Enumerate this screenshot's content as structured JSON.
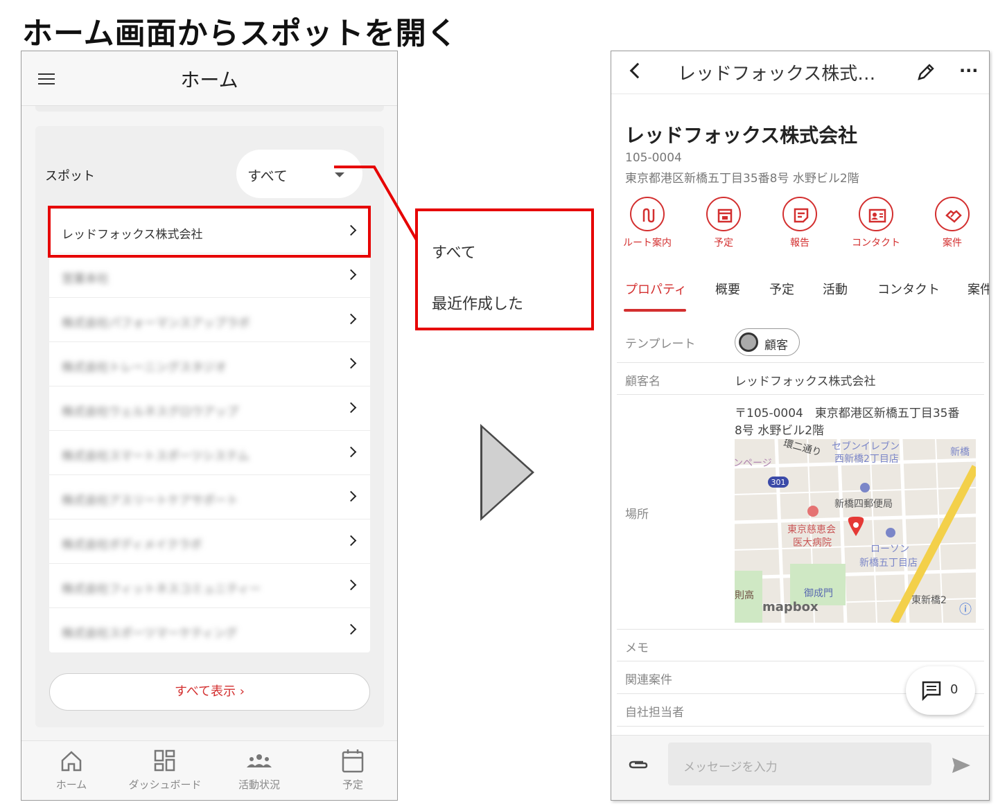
{
  "title": "ホーム画面からスポットを開く",
  "left_phone": {
    "header_title": "ホーム",
    "spot_label": "スポット",
    "filter_value": "すべて",
    "spots": [
      {
        "name": "レッドフォックス株式会社",
        "blurred": false
      },
      {
        "name": "営業本社",
        "blurred": true
      },
      {
        "name": "株式会社パフォーマンスアップラボ",
        "blurred": true
      },
      {
        "name": "株式会社トレーニングスタジオ",
        "blurred": true
      },
      {
        "name": "株式会社ウェルネスグロウアップ",
        "blurred": true
      },
      {
        "name": "株式会社スマートスポーツシステム",
        "blurred": true
      },
      {
        "name": "株式会社アスリートケアサポート",
        "blurred": true
      },
      {
        "name": "株式会社ボディメイクラボ",
        "blurred": true
      },
      {
        "name": "株式会社フィットネスコミュニティー",
        "blurred": true
      },
      {
        "name": "株式会社スポーツマーケティング",
        "blurred": true
      }
    ],
    "show_all": "すべて表示 ›",
    "nav": [
      {
        "label": "ホーム",
        "icon": "home-icon"
      },
      {
        "label": "ダッシュボード",
        "icon": "dashboard-icon"
      },
      {
        "label": "活動状況",
        "icon": "people-icon"
      },
      {
        "label": "予定",
        "icon": "calendar-icon"
      }
    ]
  },
  "dropdown_menu": {
    "items": [
      "すべて",
      "最近作成した"
    ]
  },
  "right_phone": {
    "header_title": "レッドフォックス株式…",
    "company_name": "レッドフォックス株式会社",
    "postal_code": "105-0004",
    "address": "東京都港区新橋五丁目35番8号 水野ビル2階",
    "actions": [
      {
        "label": "ルート案内",
        "icon": "route-icon"
      },
      {
        "label": "予定",
        "icon": "calendar-icon"
      },
      {
        "label": "報告",
        "icon": "report-icon"
      },
      {
        "label": "コンタクト",
        "icon": "contact-card-icon"
      },
      {
        "label": "案件",
        "icon": "handshake-icon"
      }
    ],
    "tabs": [
      "プロパティ",
      "概要",
      "予定",
      "活動",
      "コンタクト",
      "案件"
    ],
    "properties": {
      "template_label": "テンプレート",
      "template_value": "顧客",
      "customer_name_label": "顧客名",
      "customer_name_value": "レッドフォックス株式会社",
      "location_label": "場所",
      "location_address_line1": "〒105-0004　東京都港区新橋五丁目35番",
      "location_address_line2": "8号 水野ビル2階",
      "memo_label": "メモ",
      "related_label": "関連案件",
      "owner_label": "自社担当者"
    },
    "map_labels": {
      "street": "環二通り",
      "seven": "セブンイレブン",
      "seven_branch": "西新橋2丁目店",
      "shinbashi": "新橋",
      "route": "301",
      "post": "新橋四郵便局",
      "hospital1": "東京慈恵会",
      "hospital2": "医大病院",
      "lawson": "ローソン",
      "lawson_branch": "新橋五丁目店",
      "onarimon": "御成門",
      "higashi": "東新橋2",
      "logo": "mapbox",
      "left_edge": "ンページ",
      "sokuko": "則高"
    },
    "comment_count": "0",
    "message_placeholder": "メッセージを入力"
  },
  "colors": {
    "accent": "#d32f2f",
    "highlight_box": "#e60000"
  }
}
